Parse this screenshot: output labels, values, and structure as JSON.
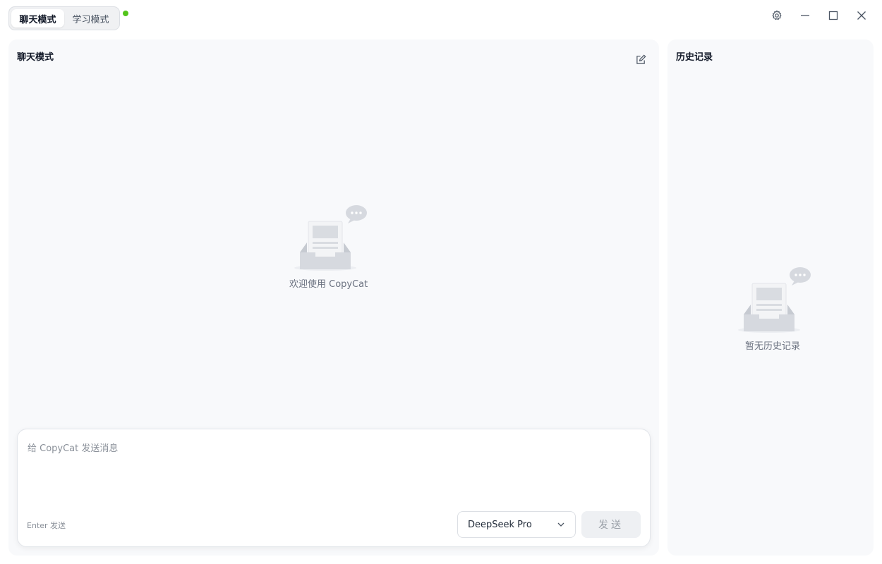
{
  "titlebar": {
    "modes": [
      {
        "label": "聊天模式",
        "active": true
      },
      {
        "label": "学习模式",
        "active": false
      }
    ],
    "status_color": "#52c41a",
    "controls": [
      "gear-icon",
      "minimize-icon",
      "maximize-icon",
      "close-icon"
    ]
  },
  "chat": {
    "title": "聊天模式",
    "empty_text": "欢迎使用 CopyCat",
    "input": {
      "placeholder": "给 CopyCat 发送消息",
      "value": ""
    },
    "hint": "Enter 发送",
    "model": "DeepSeek Pro",
    "send_label": "发送"
  },
  "history": {
    "title": "历史记录",
    "empty_text": "暂无历史记录"
  }
}
